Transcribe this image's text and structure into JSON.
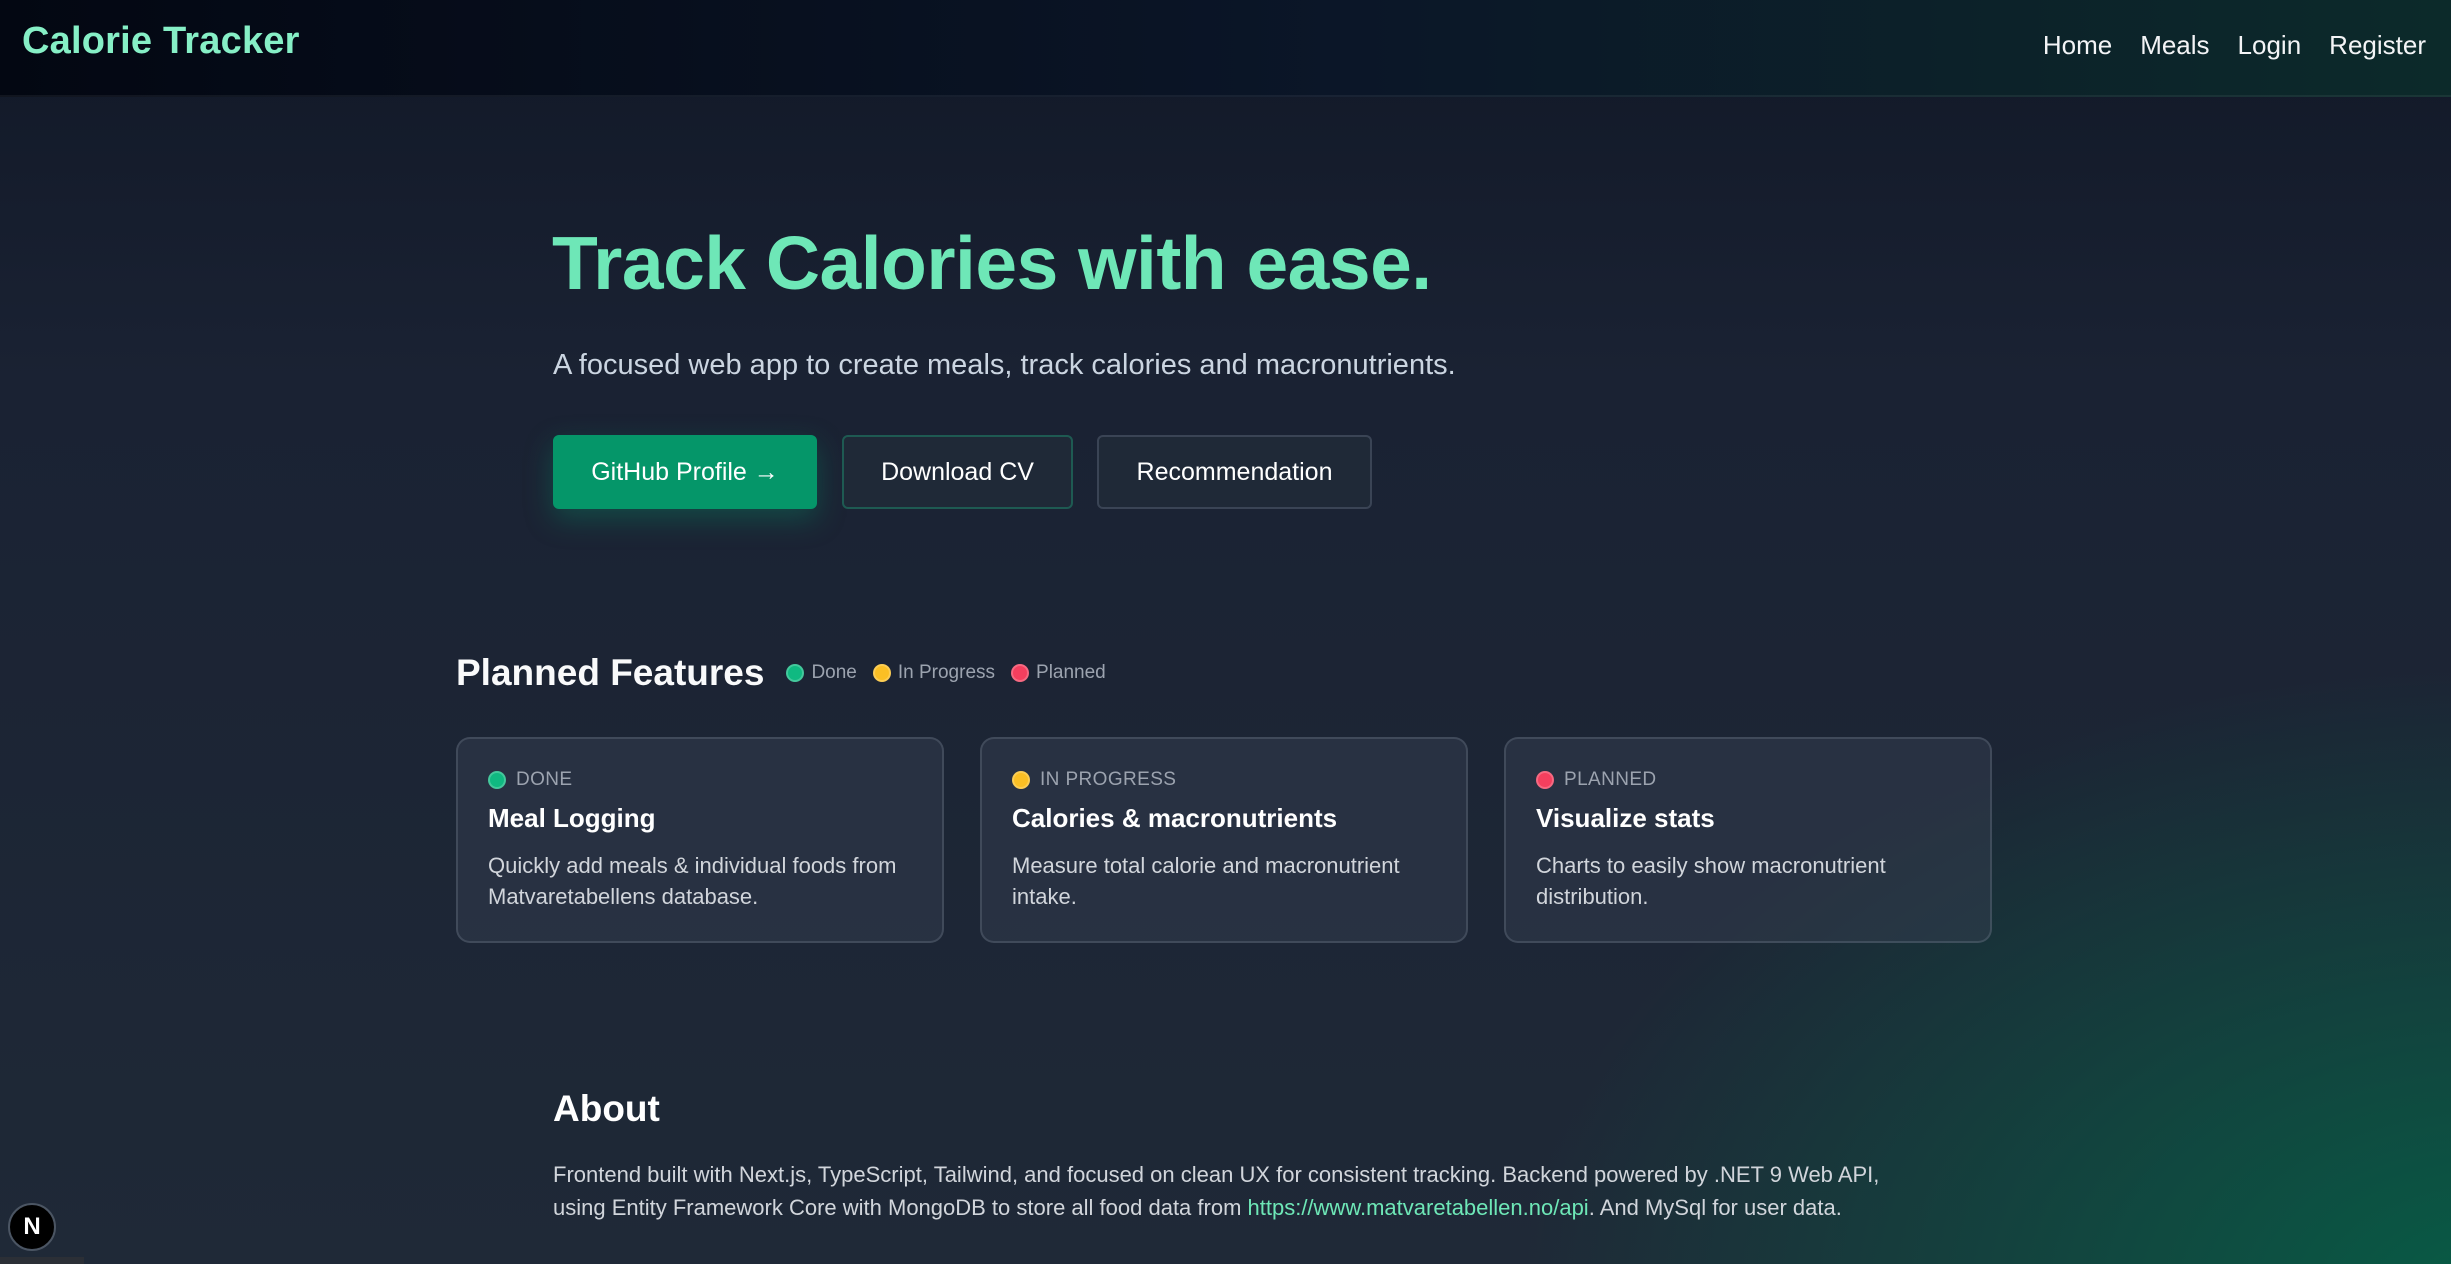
{
  "header": {
    "brand": "Calorie Tracker",
    "nav": [
      "Home",
      "Meals",
      "Login",
      "Register"
    ]
  },
  "hero": {
    "title": "Track Calories with ease.",
    "subtitle": "A focused web app to create meals, track calories and macronutrients.",
    "buttons": {
      "github": "GitHub Profile →",
      "cv": "Download CV",
      "recommendation": "Recommendation"
    }
  },
  "features": {
    "title": "Planned Features",
    "legend": {
      "done": "Done",
      "in_progress": "In Progress",
      "planned": "Planned"
    },
    "cards": [
      {
        "status": "DONE",
        "title": "Meal Logging",
        "description": "Quickly add meals & individual foods from Matvaretabellens database."
      },
      {
        "status": "IN PROGRESS",
        "title": "Calories & macronutrients",
        "description": "Measure total calorie and macronutrient intake."
      },
      {
        "status": "PLANNED",
        "title": "Visualize stats",
        "description": "Charts to easily show macronutrient distribution."
      }
    ]
  },
  "about": {
    "title": "About",
    "text_before_link": "Frontend built with Next.js, TypeScript, Tailwind, and focused on clean UX for consistent tracking. Backend powered by .NET 9 Web API, using Entity Framework Core with MongoDB to store all food data from ",
    "link": "https://www.matvaretabellen.no/api",
    "text_after_link": ". And MySql for user data."
  },
  "dev_badge": {
    "letter": "N"
  },
  "colors": {
    "accent": "#6ee7b7",
    "brand": "#86efc6",
    "primary_button": "#059669",
    "status_done": "#10b981",
    "status_in_progress": "#fbbf24",
    "status_planned": "#f43f5e"
  },
  "icons": {
    "done": "green-status-dot",
    "in_progress": "yellow-status-dot",
    "planned": "red-status-dot",
    "dev_badge": "nextjs-logo-icon"
  }
}
